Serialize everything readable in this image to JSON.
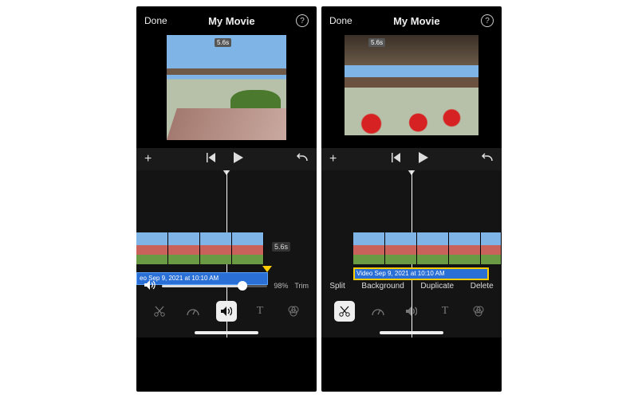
{
  "left": {
    "header": {
      "done": "Done",
      "title": "My Movie"
    },
    "preview_duration": "5.6s",
    "timeline": {
      "clip_duration_chip": "5.6s",
      "audio_label": "eo Sep 9, 2021 at 10:10 AM"
    },
    "volume": {
      "percent_label": "98%",
      "trim_label": "Trim",
      "fill_pct": 98
    },
    "tools": [
      "scissors",
      "speed",
      "audio",
      "text",
      "filters"
    ],
    "active_tool": "audio"
  },
  "right": {
    "header": {
      "done": "Done",
      "title": "My Movie"
    },
    "preview_duration": "5.6s",
    "timeline": {
      "audio_label": "Video Sep 9, 2021 at 10:10 AM"
    },
    "actions": {
      "split": "Split",
      "background": "Background",
      "duplicate": "Duplicate",
      "delete": "Delete"
    },
    "tools": [
      "scissors",
      "speed",
      "audio",
      "text",
      "filters"
    ],
    "active_tool": "scissors"
  }
}
